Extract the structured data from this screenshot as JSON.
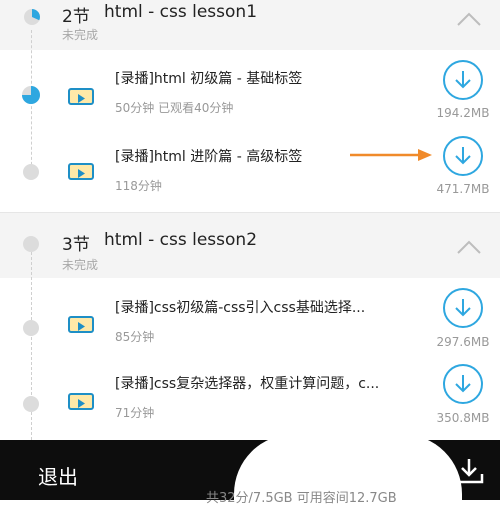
{
  "sections": [
    {
      "number": "2节",
      "title": "html - css lesson1",
      "status": "未完成",
      "lessons": [
        {
          "title": "[录播]html 初级篇 - 基础标签",
          "meta": "50分钟 已观看40分钟",
          "size": "194.2MB"
        },
        {
          "title": "[录播]html 进阶篇 - 高级标签",
          "meta": "118分钟",
          "size": "471.7MB"
        }
      ]
    },
    {
      "number": "3节",
      "title": "html - css lesson2",
      "status": "未完成",
      "lessons": [
        {
          "title": "[录播]css初级篇-css引入css基础选择...",
          "meta": "85分钟",
          "size": "297.6MB"
        },
        {
          "title": "[录播]css复杂选择器，权重计算问题，c...",
          "meta": "71分钟",
          "size": "350.8MB"
        }
      ]
    }
  ],
  "bottom_bar": {
    "exit_label": "退出",
    "storage_text": "共32分/7.5GB  可用容间12.7GB"
  },
  "colors": {
    "accent_blue": "#2ea7e0",
    "annotation_arrow": "#f08a2a",
    "bottom_bar": "#0d0d0d"
  },
  "icons": {
    "collapse": "chevron-up-icon",
    "download": "download-icon",
    "video": "video-play-icon"
  }
}
